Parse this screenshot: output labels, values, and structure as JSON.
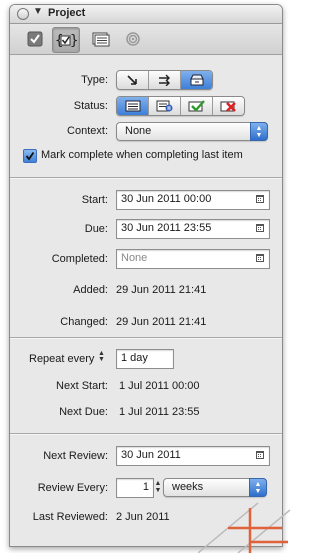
{
  "window": {
    "title": "Project"
  },
  "tabs": [
    {
      "icon": "checkbox-icon",
      "selected": false
    },
    {
      "icon": "braces-check-icon",
      "selected": true
    },
    {
      "icon": "notes-icon",
      "selected": false
    },
    {
      "icon": "attachment-icon",
      "selected": false
    }
  ],
  "type": {
    "label": "Type:",
    "options": [
      "sequential-icon",
      "parallel-icon",
      "single-action-icon"
    ],
    "selected_index": 2
  },
  "status": {
    "label": "Status:",
    "options": [
      "active-icon",
      "on-hold-icon",
      "completed-icon",
      "dropped-icon"
    ],
    "selected_index": 0
  },
  "context": {
    "label": "Context:",
    "value": "None"
  },
  "mark_complete": {
    "label": "Mark complete when completing last item",
    "checked": true
  },
  "dates": {
    "start": {
      "label": "Start:",
      "value": "30 Jun 2011 00:00"
    },
    "due": {
      "label": "Due:",
      "value": "30 Jun 2011 23:55"
    },
    "completed": {
      "label": "Completed:",
      "placeholder": "None"
    },
    "added": {
      "label": "Added:",
      "value": "29 Jun 2011 21:41"
    },
    "changed": {
      "label": "Changed:",
      "value": "29 Jun 2011 21:41"
    }
  },
  "repeat": {
    "label": "Repeat every",
    "value": "1 day",
    "next_start": {
      "label": "Next Start:",
      "value": "1 Jul 2011 00:00"
    },
    "next_due": {
      "label": "Next Due:",
      "value": "1 Jul 2011 23:55"
    }
  },
  "review": {
    "next_review": {
      "label": "Next Review:",
      "value": "30 Jun 2011"
    },
    "review_every": {
      "label": "Review Every:",
      "value": "1",
      "unit": "weeks"
    },
    "last_reviewed": {
      "label": "Last Reviewed:",
      "value": "2 Jun 2011"
    }
  },
  "colors": {
    "accent": "#3d7fd8",
    "panel": "#e8e8e8",
    "watermark": "#e0623a"
  }
}
